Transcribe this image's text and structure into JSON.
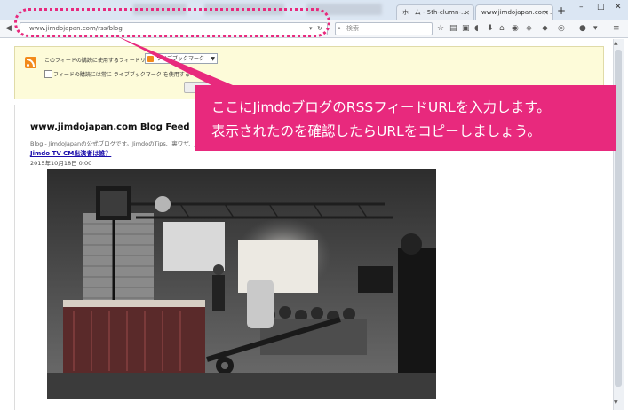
{
  "browser": {
    "tabs": [
      {
        "label": "ホーム - 5th-clumn-..."
      },
      {
        "label": "www.jimdojapan.com ..."
      }
    ],
    "new_tab": "+",
    "window_controls": {
      "minimize": "–",
      "maximize": "□",
      "close": "✕"
    },
    "url": "www.jimdojapan.com/rss/blog",
    "search_placeholder": "検索",
    "accent_color": "#e8297d"
  },
  "feed_panel": {
    "reader_label": "このフィードの購読に使用するフィードリーダー:",
    "reader_selected": "ライブブックマーク",
    "always_use_label": "フィードの購読には常に ライブブックマーク を使用する"
  },
  "feed": {
    "title": "www.jimdojapan.com Blog Feed",
    "description": "Blog - JimdoJapanの公式ブログです。JimdoのTips、裏ワザ、Jimdo Japanからのお知らせを...",
    "post_title": "Jimdo TV CM出演者は誰？",
    "post_date": "2015年10月18日 0:00"
  },
  "callout": {
    "line1": "ここにJimdoブログのRSSフィードURLを入力します。",
    "line2": "表示されたのを確認したらURLをコピーしましょう。"
  }
}
